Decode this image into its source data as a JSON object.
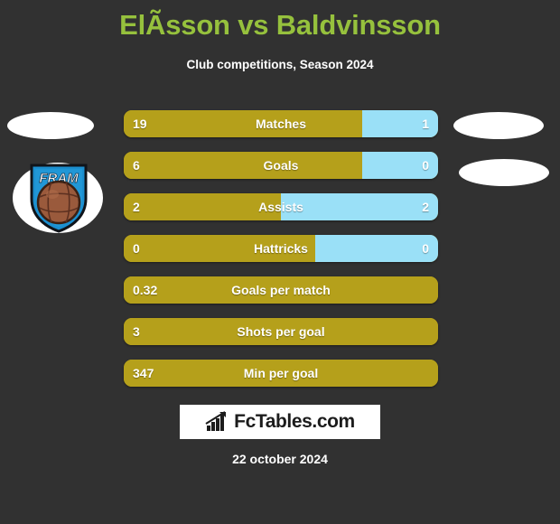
{
  "header": {
    "title": "ElÃsson vs Baldvinsson",
    "subtitle": "Club competitions, Season 2024",
    "title_color": "#96c13d"
  },
  "colors": {
    "background": "#313131",
    "home_bar": "#b5a01b",
    "away_bar": "#9ae0f7",
    "text": "#ffffff"
  },
  "badge": {
    "name": "fram-club-badge",
    "text": "FRAM",
    "shield_color": "#1b8fd0",
    "ball_color": "#9a5a3c"
  },
  "stats": [
    {
      "label": "Matches",
      "home": "19",
      "away": "1",
      "home_pct": 76,
      "has_away": true
    },
    {
      "label": "Goals",
      "home": "6",
      "away": "0",
      "home_pct": 76,
      "has_away": true
    },
    {
      "label": "Assists",
      "home": "2",
      "away": "2",
      "home_pct": 50,
      "has_away": true
    },
    {
      "label": "Hattricks",
      "home": "0",
      "away": "0",
      "home_pct": 61,
      "has_away": true
    },
    {
      "label": "Goals per match",
      "home": "0.32",
      "away": "",
      "home_pct": 100,
      "has_away": false
    },
    {
      "label": "Shots per goal",
      "home": "3",
      "away": "",
      "home_pct": 100,
      "has_away": false
    },
    {
      "label": "Min per goal",
      "home": "347",
      "away": "",
      "home_pct": 100,
      "has_away": false
    }
  ],
  "footer": {
    "logo_text": "FcTables.com",
    "logo_icon": "bar-chart-icon",
    "date": "22 october 2024"
  }
}
